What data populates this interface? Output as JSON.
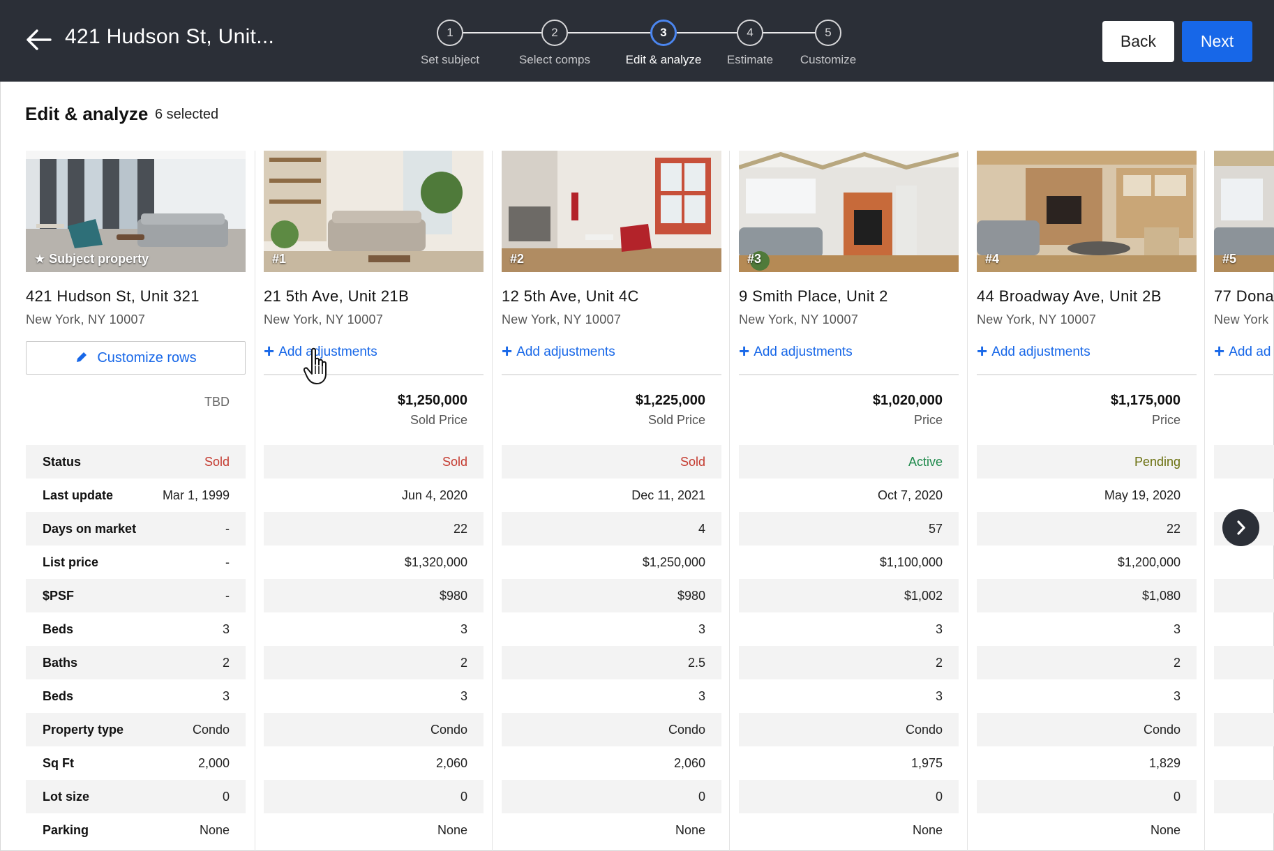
{
  "header": {
    "title": "421 Hudson St,  Unit...",
    "back_icon": "back-arrow-icon",
    "steps": [
      {
        "number": "1",
        "label": "Set subject"
      },
      {
        "number": "2",
        "label": "Select comps"
      },
      {
        "number": "3",
        "label": "Edit & analyze"
      },
      {
        "number": "4",
        "label": "Estimate"
      },
      {
        "number": "5",
        "label": "Customize"
      }
    ],
    "active_step": 3,
    "back_label": "Back",
    "next_label": "Next"
  },
  "page": {
    "title": "Edit & analyze",
    "selected_count": "6 selected"
  },
  "subject": {
    "badge": "Subject property",
    "address": "421 Hudson St, Unit 321",
    "city": "New York, NY 10007",
    "customize_label": "Customize rows",
    "price_value": "TBD"
  },
  "row_labels": [
    "Status",
    "Last update",
    "Days on market",
    "List price",
    "$PSF",
    "Beds",
    "Baths",
    "Beds",
    "Property type",
    "Sq Ft",
    "Lot size",
    "Parking"
  ],
  "subject_values": [
    "Sold",
    "Mar 1, 1999",
    "-",
    "-",
    "-",
    "3",
    "2",
    "3",
    "Condo",
    "2,000",
    "0",
    "None"
  ],
  "add_adjustments_label": "Add adjustments",
  "comps": [
    {
      "badge": "#1",
      "address": "21 5th Ave, Unit 21B",
      "city": "New York, NY 10007",
      "price": "$1,250,000",
      "price_label": "Sold Price",
      "status_kind": "sold",
      "values": [
        "Sold",
        "Jun 4, 2020",
        "22",
        "$1,320,000",
        "$980",
        "3",
        "2",
        "3",
        "Condo",
        "2,060",
        "0",
        "None"
      ]
    },
    {
      "badge": "#2",
      "address": "12 5th Ave, Unit 4C",
      "city": "New York, NY 10007",
      "price": "$1,225,000",
      "price_label": "Sold Price",
      "status_kind": "sold",
      "values": [
        "Sold",
        "Dec 11, 2021",
        "4",
        "$1,250,000",
        "$980",
        "3",
        "2.5",
        "3",
        "Condo",
        "2,060",
        "0",
        "None"
      ]
    },
    {
      "badge": "#3",
      "address": "9 Smith Place, Unit 2",
      "city": "New York, NY 10007",
      "price": "$1,020,000",
      "price_label": "Price",
      "status_kind": "active",
      "values": [
        "Active",
        "Oct 7, 2020",
        "57",
        "$1,100,000",
        "$1,002",
        "3",
        "2",
        "3",
        "Condo",
        "1,975",
        "0",
        "None"
      ]
    },
    {
      "badge": "#4",
      "address": "44 Broadway Ave, Unit 2B",
      "city": "New York, NY 10007",
      "price": "$1,175,000",
      "price_label": "Price",
      "status_kind": "pending",
      "values": [
        "Pending",
        "May 19, 2020",
        "22",
        "$1,200,000",
        "$1,080",
        "3",
        "2",
        "3",
        "Condo",
        "1,829",
        "0",
        "None"
      ]
    },
    {
      "badge": "#5",
      "address": "77 Dona",
      "city": "New York",
      "price": "",
      "price_label": "",
      "status_kind": "",
      "add_label": "Add ad",
      "values": [
        "",
        "",
        "",
        "",
        "",
        "",
        "",
        "",
        "",
        "",
        "",
        ""
      ]
    }
  ],
  "colors": {
    "header_bg": "#2b2f37",
    "accent": "#1767e8",
    "sold": "#c43a2f",
    "active": "#1f8a4c",
    "pending": "#6b7110"
  },
  "icons": {
    "star": "star-icon",
    "pencil": "pencil-icon",
    "plus": "plus-icon",
    "scroll_next": "chevron-right-icon",
    "cursor": "hand-cursor-icon"
  }
}
